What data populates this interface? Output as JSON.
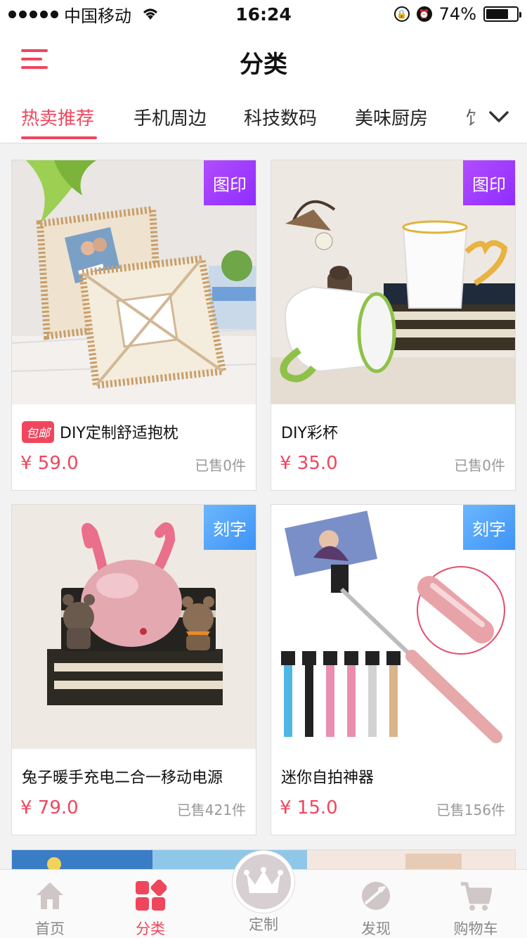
{
  "status_bar": {
    "carrier": "中国移动",
    "time": "16:24",
    "battery": "74%"
  },
  "header": {
    "title": "分类"
  },
  "tabs": [
    {
      "label": "热卖推荐",
      "active": true
    },
    {
      "label": "手机周边",
      "active": false
    },
    {
      "label": "科技数码",
      "active": false
    },
    {
      "label": "美味厨房",
      "active": false
    },
    {
      "label": "饣",
      "active": false
    }
  ],
  "products": [
    {
      "title": "DIY定制舒适抱枕",
      "badge": "包邮",
      "price": "¥ 59.0",
      "sold": "已售0件",
      "tag": "图印",
      "image": "pillow-photo"
    },
    {
      "title": "DIY彩杯",
      "price": "¥ 35.0",
      "sold": "已售0件",
      "tag": "图印",
      "image": "mug-photo"
    },
    {
      "title": "兔子暖手充电二合一移动电源",
      "price": "¥ 79.0",
      "sold": "已售421件",
      "tag": "刻字",
      "image": "rabbit-powerbank-photo"
    },
    {
      "title": "迷你自拍神器",
      "price": "¥ 15.0",
      "sold": "已售156件",
      "tag": "刻字",
      "image": "selfie-stick-photo"
    }
  ],
  "bottom_nav": [
    {
      "label": "首页",
      "icon": "home-icon",
      "active": false
    },
    {
      "label": "分类",
      "icon": "category-icon",
      "active": true
    },
    {
      "label": "定制",
      "icon": "crown-icon",
      "active": false
    },
    {
      "label": "发现",
      "icon": "discover-icon",
      "active": false
    },
    {
      "label": "购物车",
      "icon": "cart-icon",
      "active": false
    }
  ],
  "colors": {
    "accent": "#f0465d",
    "tag_purple": "#9b3bff",
    "tag_blue": "#4ba3f8",
    "muted": "#999999"
  }
}
